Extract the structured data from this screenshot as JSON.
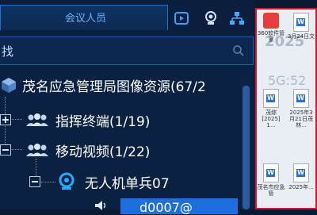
{
  "tabs": {
    "active_label": "会议人员"
  },
  "search": {
    "placeholder": "找"
  },
  "tree": {
    "root": {
      "label": "茂名应急管理局图像资源(67/2"
    },
    "groups": [
      {
        "label": "指挥终端(1/19)",
        "expanded": false
      },
      {
        "label": "移动视频(1/22)",
        "expanded": true
      }
    ],
    "child": {
      "label": "无人机单兵07"
    },
    "selected_partial": "d0007@"
  },
  "desktop": {
    "icons": [
      {
        "label": "360软件管家"
      },
      {
        "label": "3月24日文"
      },
      {
        "label": ""
      },
      {
        "label": ""
      },
      {
        "label": "茂综 [2025] 1..."
      },
      {
        "label": "2025年3月21日茂林..."
      },
      {
        "label": "茂名市应急管"
      },
      {
        "label": "2025年..."
      }
    ],
    "watermark": [
      "2025",
      "5G:52"
    ]
  },
  "colors": {
    "accent": "#1f6fd0",
    "panel": "#0b2142",
    "selection": "#1d6fe0",
    "desktop_border": "#e0142c"
  }
}
